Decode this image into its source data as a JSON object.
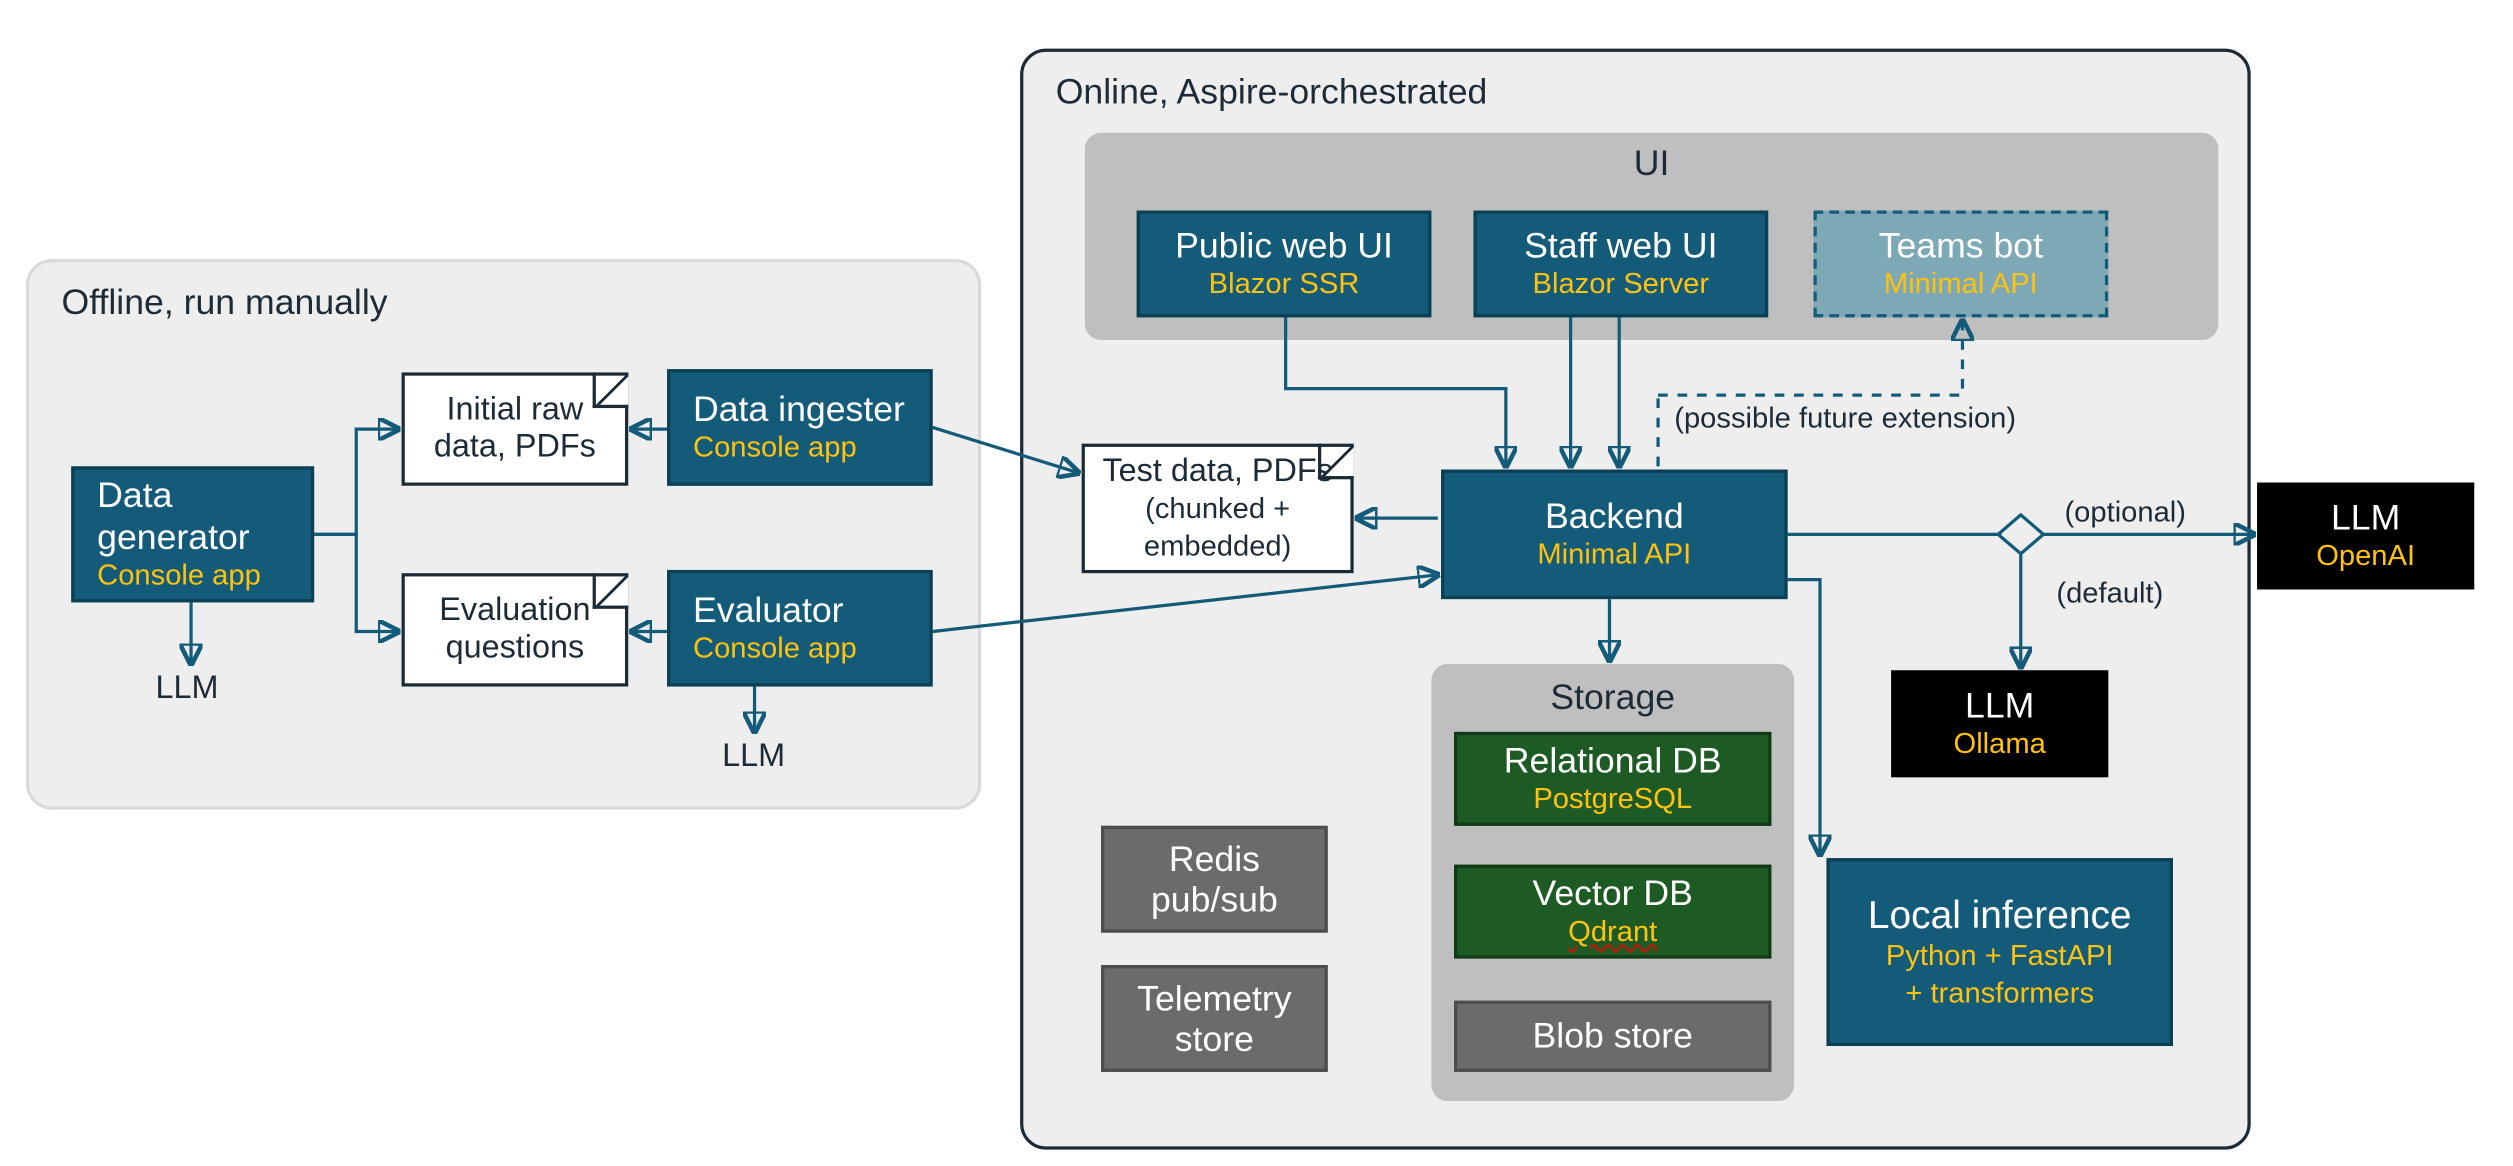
{
  "offline": {
    "title": "Offline, run manually",
    "data_generator": {
      "title": "Data generator",
      "sub": "Console app"
    },
    "data_ingester": {
      "title": "Data ingester",
      "sub": "Console app"
    },
    "evaluator": {
      "title": "Evaluator",
      "sub": "Console app"
    },
    "doc_raw": {
      "line1": "Initial raw",
      "line2": "data, PDFs"
    },
    "doc_eval": {
      "line1": "Evaluation",
      "line2": "questions"
    },
    "llm_label_left": "LLM",
    "llm_label_mid": "LLM"
  },
  "online": {
    "title": "Online, Aspire-orchestrated",
    "ui_group": {
      "title": "UI",
      "public_web": {
        "title": "Public web UI",
        "sub": "Blazor SSR"
      },
      "staff_web": {
        "title": "Staff web UI",
        "sub": "Blazor Server"
      },
      "teams_bot": {
        "title": "Teams bot",
        "sub": "Minimal API"
      }
    },
    "doc_test": {
      "line1": "Test data, PDFs",
      "line2a": "(chunked +",
      "line2b": "embedded)"
    },
    "backend": {
      "title": "Backend",
      "sub": "Minimal API"
    },
    "annot_future": "(possible future extension)",
    "annot_optional": "(optional)",
    "annot_default": "(default)",
    "storage_group": {
      "title": "Storage",
      "relational": {
        "title": "Relational DB",
        "sub": "PostgreSQL"
      },
      "vector": {
        "title": "Vector DB",
        "sub": "Qdrant"
      },
      "blob": {
        "title": "Blob store"
      }
    },
    "redis": {
      "line1": "Redis",
      "line2": "pub/sub"
    },
    "telemetry": {
      "line1": "Telemetry",
      "line2": "store"
    },
    "local_inf": {
      "title": "Local inference",
      "sub1": "Python + FastAPI",
      "sub2": "+ transformers"
    },
    "llm_ollama": {
      "title": "LLM",
      "sub": "Ollama"
    },
    "llm_openai": {
      "title": "LLM",
      "sub": "OpenAI"
    }
  }
}
